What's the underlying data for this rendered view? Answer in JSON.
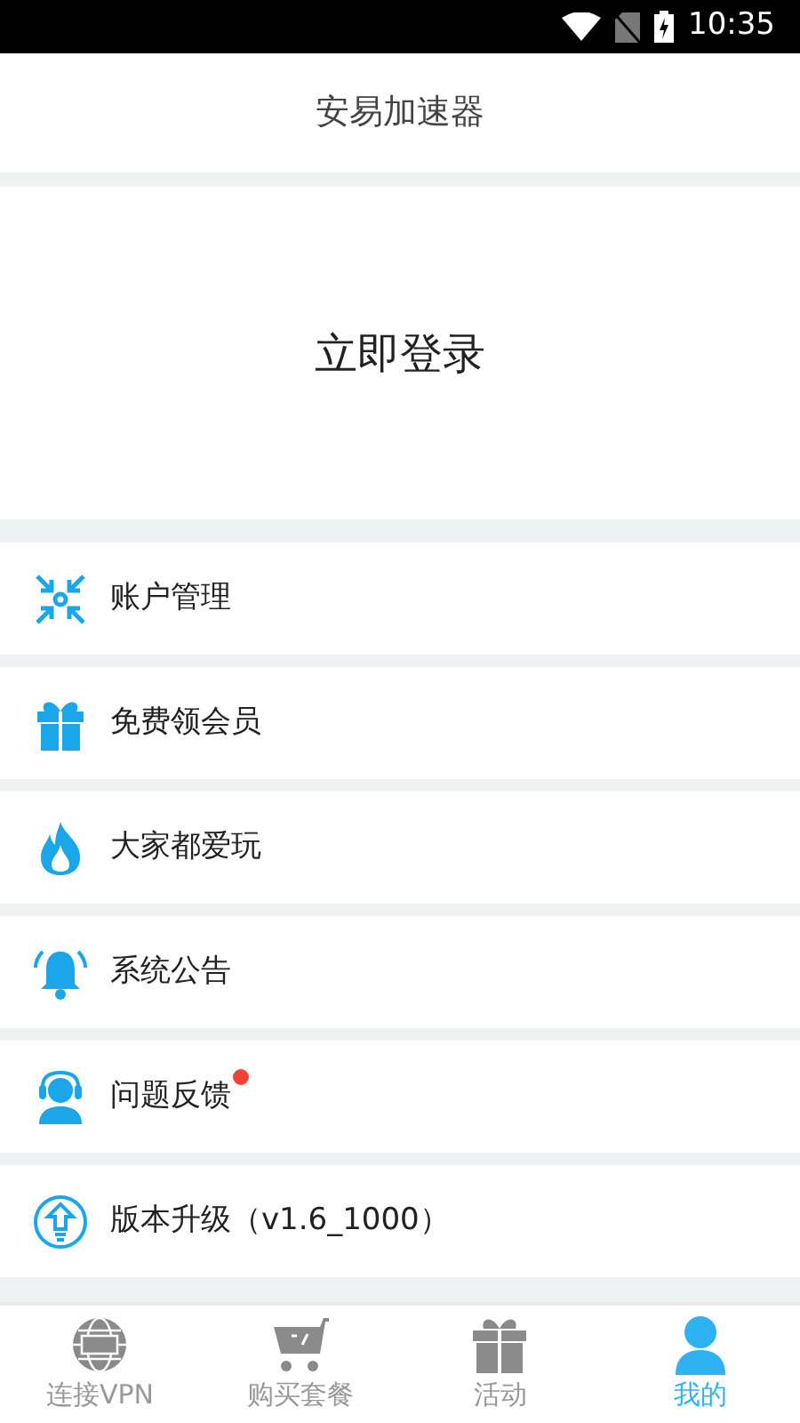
{
  "status_bar": {
    "time": "10:35"
  },
  "title": "安易加速器",
  "login": "立即登录",
  "menu": [
    {
      "kind": "arrows",
      "label": "账户管理",
      "badge": false
    },
    {
      "kind": "gift",
      "label": "免费领会员",
      "badge": false
    },
    {
      "kind": "flame",
      "label": "大家都爱玩",
      "badge": false
    },
    {
      "kind": "bell",
      "label": "系统公告",
      "badge": false
    },
    {
      "kind": "headset",
      "label": "问题反馈",
      "badge": true
    },
    {
      "kind": "upgrade",
      "label": "版本升级（v1.6_1000）",
      "badge": false
    }
  ],
  "tabs": [
    {
      "kind": "globe",
      "label": "连接VPN",
      "selected": false
    },
    {
      "kind": "cart",
      "label": "购买套餐",
      "selected": false
    },
    {
      "kind": "gift",
      "label": "活动",
      "selected": false
    },
    {
      "kind": "person",
      "label": "我的",
      "selected": true
    }
  ]
}
